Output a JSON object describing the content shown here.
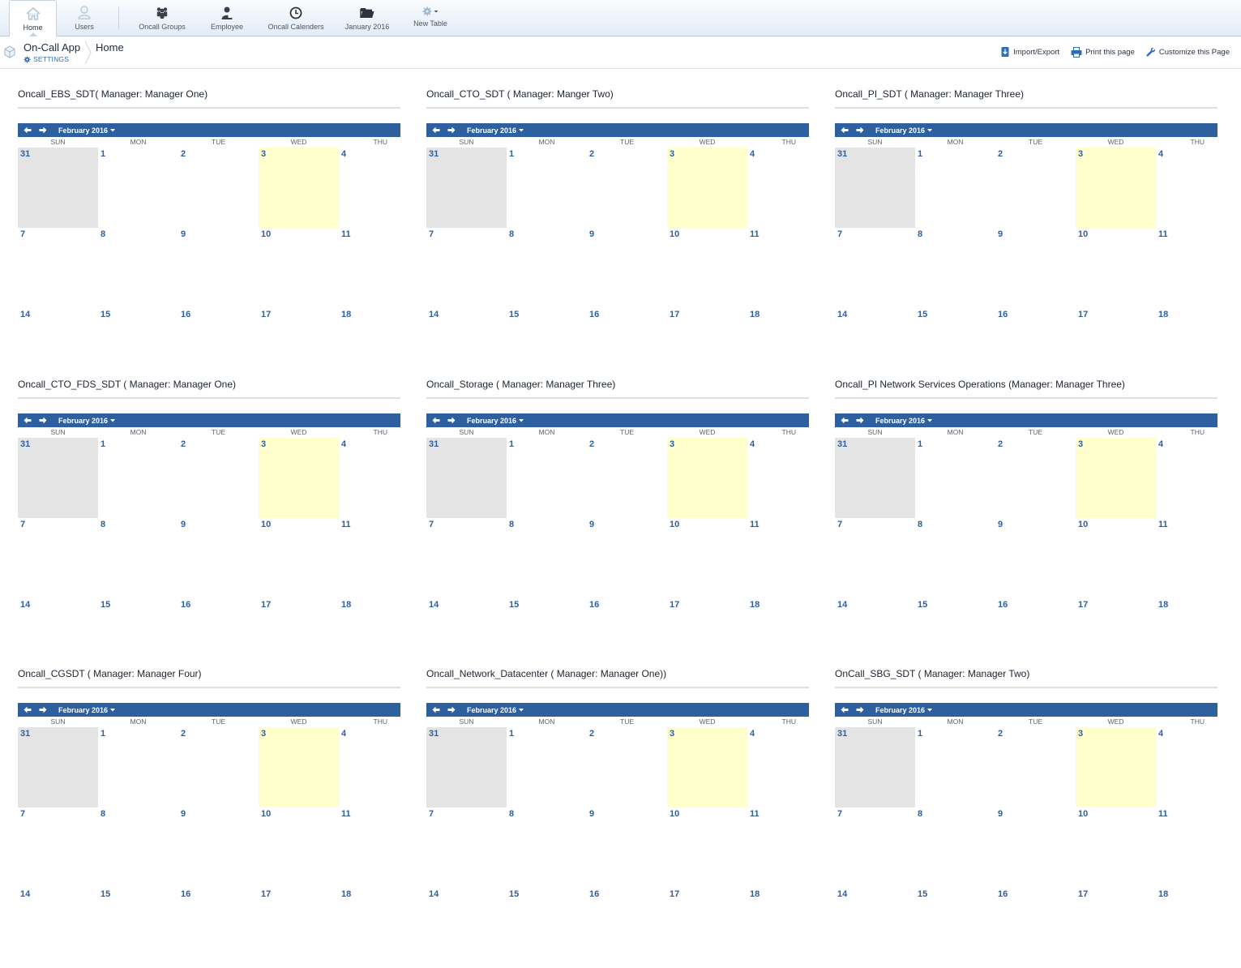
{
  "tabs": [
    {
      "label": "Home",
      "icon": "home-icon",
      "active": true
    },
    {
      "label": "Users",
      "icon": "user-icon",
      "active": false
    },
    {
      "label": "Oncall Groups",
      "icon": "group-icon",
      "active": false
    },
    {
      "label": "Employee",
      "icon": "employee-icon",
      "active": false
    },
    {
      "label": "Oncall Calenders",
      "icon": "clock-icon",
      "active": false
    },
    {
      "label": "January 2016",
      "icon": "folder-icon",
      "active": false
    },
    {
      "label": "New Table",
      "icon": "gear-dropdown-icon",
      "active": false
    }
  ],
  "breadcrumb": {
    "app_name": "On-Call App",
    "settings_label": "SETTINGS",
    "current": "Home"
  },
  "actions": [
    {
      "label": "Import/Export",
      "icon": "import-export-icon"
    },
    {
      "label": "Print this page",
      "icon": "print-icon"
    },
    {
      "label": "Customize this Page",
      "icon": "wrench-icon"
    }
  ],
  "calendar": {
    "month_label": "February 2016",
    "day_headers": [
      "SUN",
      "MON",
      "TUE",
      "WED",
      "THU"
    ],
    "weeks": [
      [
        {
          "d": "31",
          "other": true
        },
        {
          "d": "1"
        },
        {
          "d": "2"
        },
        {
          "d": "3",
          "today": true
        },
        {
          "d": "4"
        }
      ],
      [
        {
          "d": "7"
        },
        {
          "d": "8"
        },
        {
          "d": "9"
        },
        {
          "d": "10"
        },
        {
          "d": "11"
        }
      ],
      [
        {
          "d": "14"
        },
        {
          "d": "15"
        },
        {
          "d": "16"
        },
        {
          "d": "17"
        },
        {
          "d": "18"
        }
      ]
    ]
  },
  "widgets": [
    {
      "title": "Oncall_EBS_SDT( Manager: Manager One)"
    },
    {
      "title": "Oncall_CTO_SDT ( Manager: Manger Two)"
    },
    {
      "title": "Oncall_PI_SDT ( Manager: Manager Three)"
    },
    {
      "title": "Oncall_CTO_FDS_SDT ( Manager: Manager One)"
    },
    {
      "title": "Oncall_Storage ( Manager: Manager Three)"
    },
    {
      "title": "Oncall_PI Network Services Operations (Manager: Manager Three)"
    },
    {
      "title": "Oncall_CGSDT ( Manager: Manager Four)"
    },
    {
      "title": "Oncall_Network_Datacenter ( Manager: Manager One))"
    },
    {
      "title": "OnCall_SBG_SDT ( Manager: Manager Two)"
    }
  ],
  "colors": {
    "header_blue": "#2e5f9e",
    "today_highlight": "#ffffcc",
    "other_month": "#e4e4e4"
  }
}
